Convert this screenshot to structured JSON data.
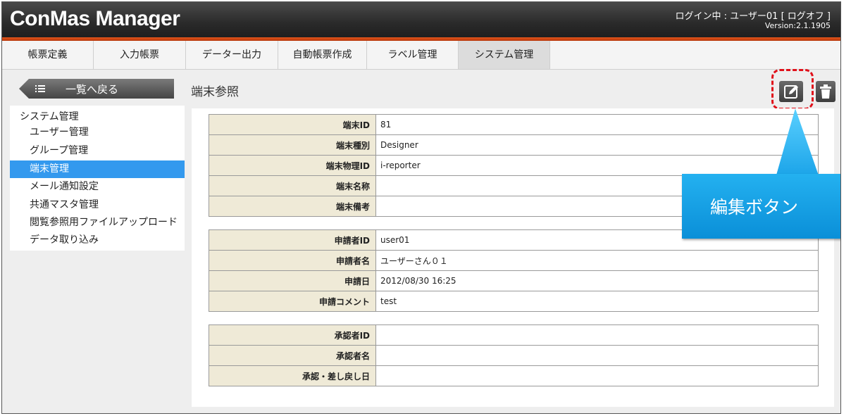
{
  "header": {
    "app_title": "ConMas Manager",
    "login_text": "ログイン中 : ユーザー01 [ ログオフ ]",
    "version": "Version:2.1.1905"
  },
  "tabs": [
    {
      "label": "帳票定義"
    },
    {
      "label": "入力帳票"
    },
    {
      "label": "データー出力"
    },
    {
      "label": "自動帳票作成"
    },
    {
      "label": "ラベル管理"
    },
    {
      "label": "システム管理",
      "active": true
    }
  ],
  "back_button": {
    "label": "一覧へ戻る",
    "icon": "list-icon"
  },
  "page_title": "端末参照",
  "toolbar": {
    "edit_icon": "edit-icon",
    "delete_icon": "trash-icon"
  },
  "sidebar": {
    "heading": "システム管理",
    "items": [
      {
        "label": "ユーザー管理"
      },
      {
        "label": "グループ管理"
      },
      {
        "label": "端末管理",
        "active": true
      },
      {
        "label": "メール通知設定"
      },
      {
        "label": "共通マスタ管理"
      },
      {
        "label": "閲覧参照用ファイルアップロード"
      },
      {
        "label": "データ取り込み"
      }
    ]
  },
  "terminal": [
    {
      "label": "端末ID",
      "value": "81"
    },
    {
      "label": "端末種別",
      "value": "Designer"
    },
    {
      "label": "端末物理ID",
      "value": "i-reporter"
    },
    {
      "label": "端末名称",
      "value": ""
    },
    {
      "label": "端末備考",
      "value": ""
    }
  ],
  "applicant": [
    {
      "label": "申請者ID",
      "value": "user01"
    },
    {
      "label": "申請者名",
      "value": "ユーザーさん０１"
    },
    {
      "label": "申請日",
      "value": "2012/08/30 16:25"
    },
    {
      "label": "申請コメント",
      "value": "test"
    }
  ],
  "approver": [
    {
      "label": "承認者ID",
      "value": ""
    },
    {
      "label": "承認者名",
      "value": ""
    },
    {
      "label": "承認・差し戻し日",
      "value": ""
    }
  ],
  "callout": {
    "text": "編集ボタン"
  },
  "colors": {
    "accent": "#e2561c",
    "active": "#3399ee",
    "callout": "#1aa3e8",
    "highlight": "#e0101a"
  }
}
